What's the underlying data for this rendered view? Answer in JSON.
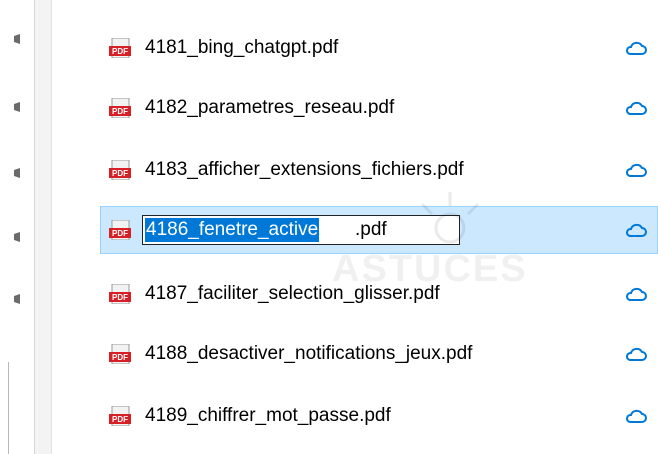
{
  "files": [
    {
      "name": "4181_bing_chatgpt.pdf",
      "icon": "pdf-icon",
      "status_icon": "cloud-icon"
    },
    {
      "name": "4182_parametres_reseau.pdf",
      "icon": "pdf-icon",
      "status_icon": "cloud-icon"
    },
    {
      "name": "4183_afficher_extensions_fichiers.pdf",
      "icon": "pdf-icon",
      "status_icon": "cloud-icon"
    },
    {
      "name": "4186_fenetre_active.pdf",
      "icon": "pdf-icon",
      "status_icon": "cloud-icon",
      "selected": true,
      "renaming": true
    },
    {
      "name": "4187_faciliter_selection_glisser.pdf",
      "icon": "pdf-icon",
      "status_icon": "cloud-icon"
    },
    {
      "name": "4188_desactiver_notifications_jeux.pdf",
      "icon": "pdf-icon",
      "status_icon": "cloud-icon"
    },
    {
      "name": "4189_chiffrer_mot_passe.pdf",
      "icon": "pdf-icon",
      "status_icon": "cloud-icon"
    }
  ],
  "rename_edit": {
    "selected_text": "4186_fenetre_active",
    "unselected_text": ".pdf"
  },
  "nav_pins": [
    "pin-icon",
    "pin-icon",
    "pin-icon",
    "pin-icon",
    "pin-icon"
  ],
  "watermark": "ASTUCES",
  "colors": {
    "selection_background": "#cce8ff",
    "selection_border": "#99d1ff",
    "text_highlight": "#0078d7",
    "cloud_icon": "#0078d7",
    "pdf_icon_red": "#d71f26"
  }
}
